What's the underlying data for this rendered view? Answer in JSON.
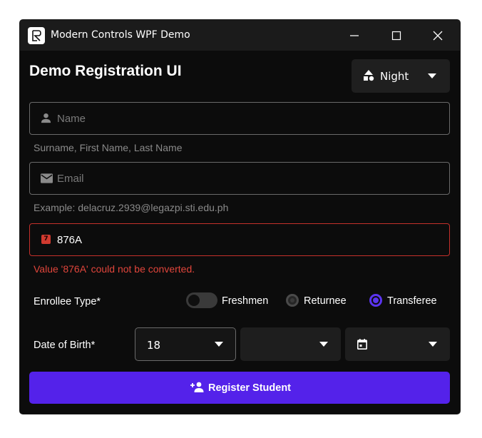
{
  "window": {
    "title": "Modern Controls WPF Demo",
    "app_icon": "app-logo-icon"
  },
  "header": {
    "title": "Demo Registration UI",
    "theme": {
      "selected": "Night",
      "icon": "shapes-icon"
    }
  },
  "form": {
    "name": {
      "placeholder": "Name",
      "value": "",
      "icon": "person-icon",
      "hint": "Surname, First Name, Last Name"
    },
    "email": {
      "placeholder": "Email",
      "value": "",
      "icon": "mail-icon",
      "hint": "Example: delacruz.2939@legazpi.sti.edu.ph"
    },
    "student_number": {
      "value": "876A",
      "icon": "error-badge-icon",
      "badge_text": "7",
      "error": "Value '876A' could not be converted."
    },
    "enrollee_type": {
      "label": "Enrollee Type*",
      "toggle_label": "Freshmen",
      "toggle_on": false,
      "options": [
        "Returnee",
        "Transferee"
      ],
      "selected": "Transferee"
    },
    "dob": {
      "label": "Date of Birth*",
      "day": "18",
      "month": "",
      "year": "",
      "year_icon": "calendar-icon"
    },
    "submit_label": "Register Student",
    "submit_icon": "add-person-icon"
  },
  "colors": {
    "accent": "#5422ea",
    "error": "#e0453b",
    "background": "#0c0c0c"
  }
}
